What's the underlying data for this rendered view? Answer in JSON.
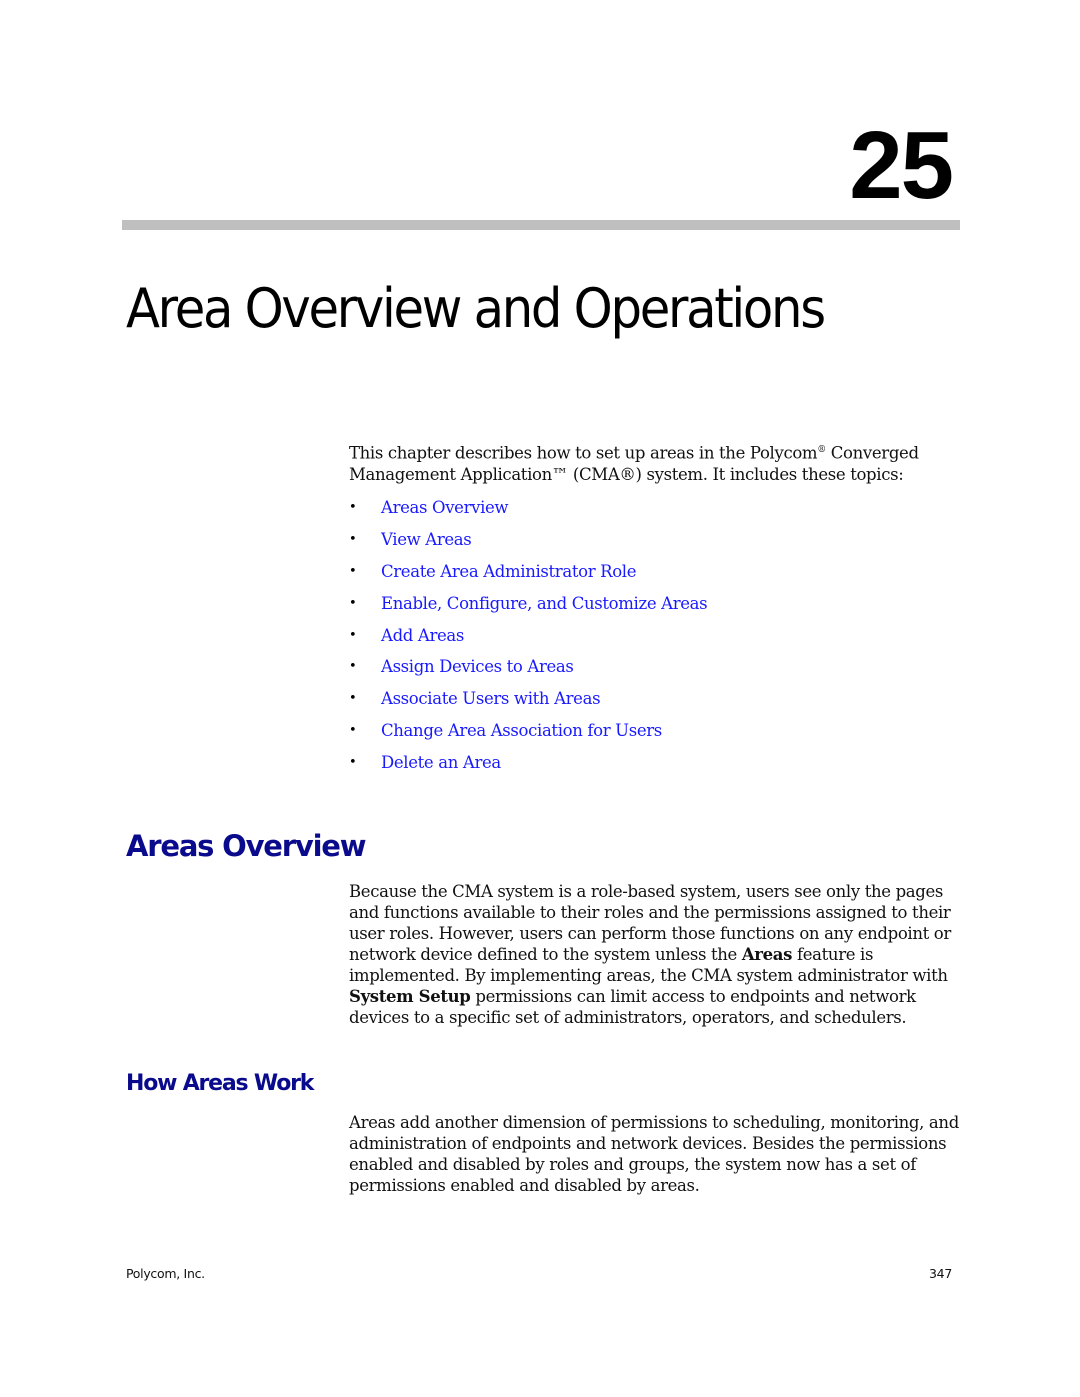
{
  "chapter": {
    "number": "25",
    "title": "Area Overview and Operations"
  },
  "intro": {
    "text_part1": "This chapter describes how to set up areas in the Polycom",
    "reg_mark": "®",
    "text_part2": " Converged Management Application™ (CMA®) system. It includes these topics:"
  },
  "topics": [
    {
      "label": "Areas Overview"
    },
    {
      "label": "View Areas"
    },
    {
      "label": "Create Area Administrator Role"
    },
    {
      "label": "Enable, Configure, and Customize Areas"
    },
    {
      "label": "Add Areas"
    },
    {
      "label": "Assign Devices to Areas"
    },
    {
      "label": "Associate Users with Areas"
    },
    {
      "label": "Change Area Association for Users"
    },
    {
      "label": "Delete an Area"
    }
  ],
  "bullet_glyph": "•",
  "sections": {
    "areas_overview": {
      "heading": "Areas Overview",
      "p_part1": "Because the CMA system is a role-based system, users see only the pages and functions available to their roles and the permissions assigned to their user roles. However, users can perform those functions on any endpoint or network device defined to the system unless the ",
      "p_bold1": "Areas",
      "p_part2": " feature is implemented. By implementing areas, the CMA system administrator with ",
      "p_bold2": "System Setup",
      "p_part3": " permissions can limit access to endpoints and network devices to a specific set of administrators, operators, and schedulers."
    },
    "how_areas_work": {
      "heading": "How Areas Work",
      "paragraph": "Areas add another dimension of permissions to scheduling, monitoring, and administration of endpoints and network devices. Besides the permissions enabled and disabled by roles and groups, the system now has a set of permissions enabled and disabled by areas."
    }
  },
  "footer": {
    "company": "Polycom, Inc.",
    "page_number": "347"
  },
  "colors": {
    "link": "#1a1aff",
    "heading": "#0a0a8c",
    "rule": "#bfbfbf"
  }
}
